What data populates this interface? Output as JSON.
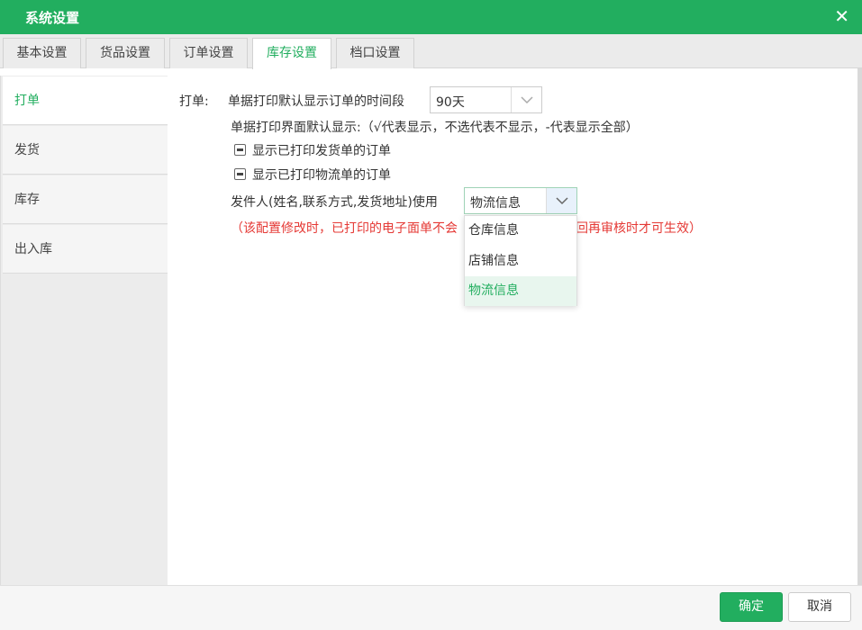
{
  "window": {
    "title": "系统设置",
    "close_icon": "close-icon"
  },
  "tabs": [
    {
      "label": "基本设置",
      "active": false
    },
    {
      "label": "货品设置",
      "active": false
    },
    {
      "label": "订单设置",
      "active": false
    },
    {
      "label": "库存设置",
      "active": true
    },
    {
      "label": "档口设置",
      "active": false
    }
  ],
  "sidebar": {
    "items": [
      {
        "label": "打单",
        "active": true
      },
      {
        "label": "发货",
        "active": false
      },
      {
        "label": "库存",
        "active": false
      },
      {
        "label": "出入库",
        "active": false
      }
    ]
  },
  "print_settings": {
    "section_label": "打单:",
    "default_period_label": "单据打印默认显示订单的时间段",
    "default_period_value": "90天",
    "default_display_label": "单据打印界面默认显示:（√代表显示，不选代表不显示，-代表显示全部）",
    "checkbox_printed_delivery": "显示已打印发货单的订单",
    "checkbox_printed_logistics": "显示已打印物流单的订单",
    "sender_label": "发件人(姓名,联系方式,发货地址)使用",
    "sender_value": "物流信息",
    "warning_left": "（该配置修改时，已打印的电子面单不会",
    "warning_right": "返回再审核时才可生效）",
    "sender_options": [
      "仓库信息",
      "店铺信息",
      "物流信息"
    ],
    "sender_selected": "物流信息"
  },
  "footer": {
    "ok_label": "确定",
    "cancel_label": "取消"
  },
  "colors": {
    "accent": "#22ae5f",
    "warning": "#e53935"
  }
}
